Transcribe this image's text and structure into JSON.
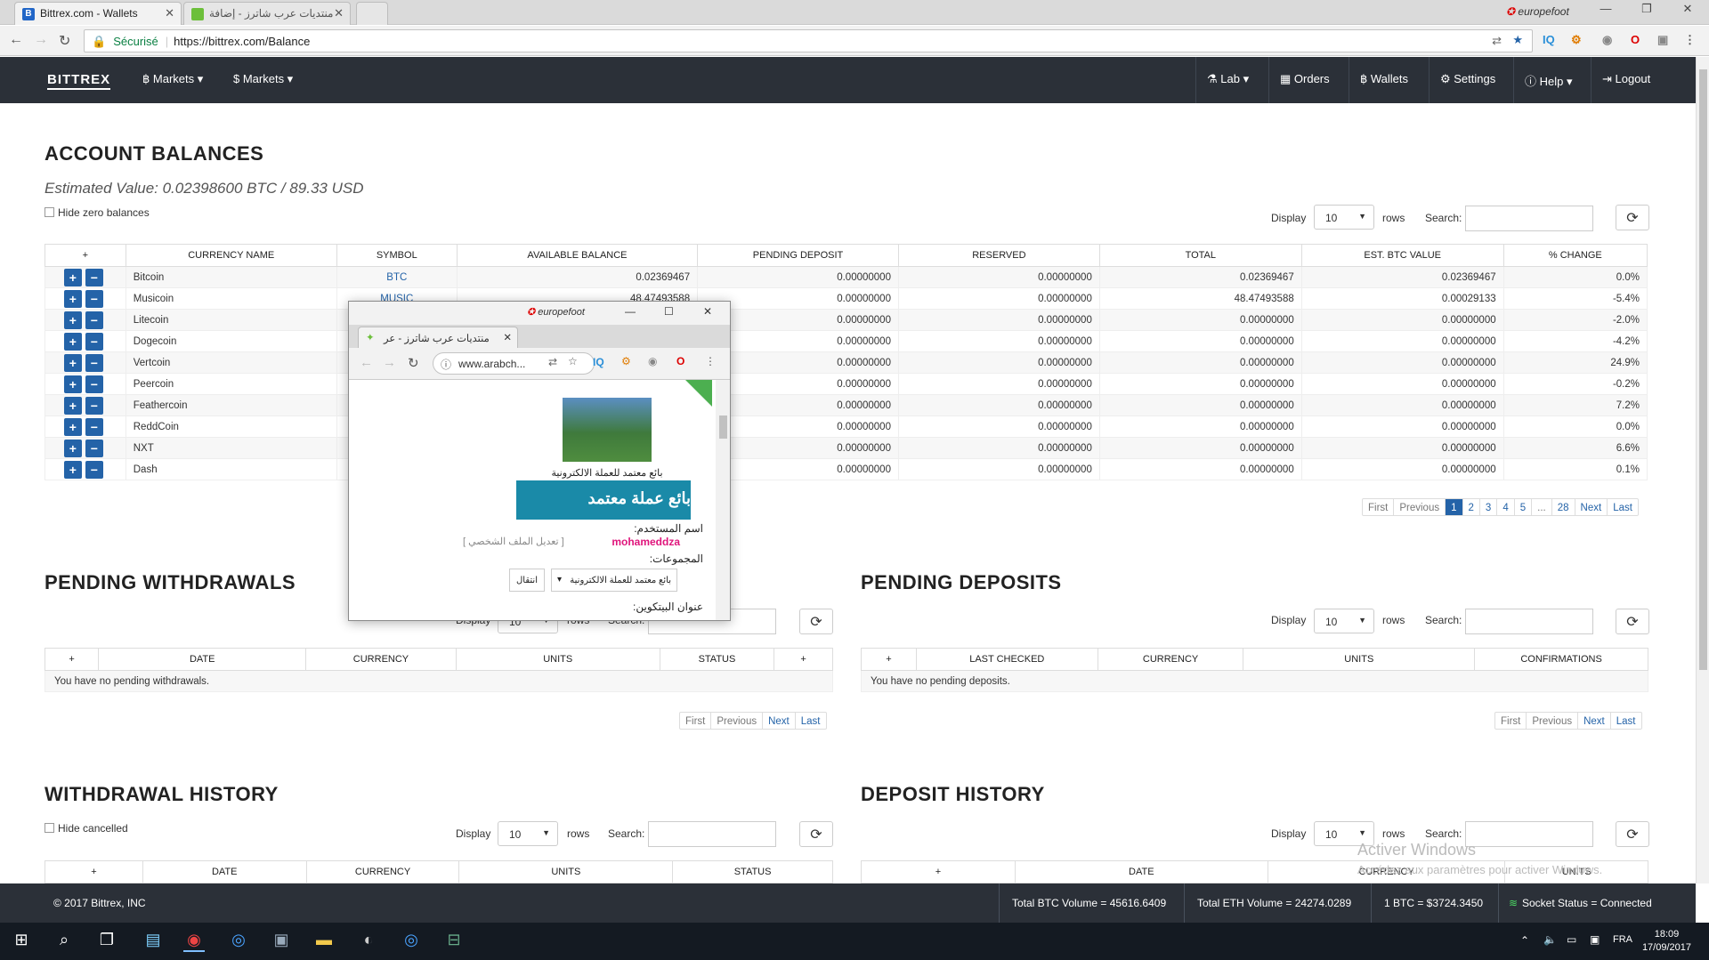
{
  "browser": {
    "tabs": [
      {
        "title": "Bittrex.com - Wallets",
        "favicon": "B"
      },
      {
        "title": "منتديات عرب شاترز - إضافة",
        "favicon": ""
      }
    ],
    "profile": "europefoot",
    "secure_label": "Sécurisé",
    "url": "https://bittrex.com/Balance",
    "ext_iq": "IQ"
  },
  "nav": {
    "brand": "BITTREX",
    "left": [
      {
        "label": "฿ Markets ▾"
      },
      {
        "label": "$ Markets ▾"
      }
    ],
    "right": [
      {
        "label": "⚗ Lab ▾"
      },
      {
        "label": "▦ Orders"
      },
      {
        "label": "฿ Wallets"
      },
      {
        "label": "⚙ Settings"
      },
      {
        "label": "ⓘ Help ▾"
      },
      {
        "label": "⇥ Logout"
      }
    ]
  },
  "account": {
    "title": "ACCOUNT BALANCES",
    "estimated": "Estimated Value: 0.02398600 BTC / 89.33 USD",
    "hide_zero": "Hide zero balances",
    "display_label": "Display",
    "display_value": "10",
    "rows_label": "rows",
    "search_label": "Search:",
    "columns": [
      "+",
      "CURRENCY NAME",
      "SYMBOL",
      "AVAILABLE BALANCE",
      "PENDING DEPOSIT",
      "RESERVED",
      "TOTAL",
      "EST. BTC VALUE",
      "% CHANGE"
    ],
    "rows": [
      {
        "name": "Bitcoin",
        "symbol": "BTC",
        "available": "0.02369467",
        "pending": "0.00000000",
        "reserved": "0.00000000",
        "total": "0.02369467",
        "btc": "0.02369467",
        "change": "0.0%"
      },
      {
        "name": "Musicoin",
        "symbol": "MUSIC",
        "available": "48.47493588",
        "pending": "0.00000000",
        "reserved": "0.00000000",
        "total": "48.47493588",
        "btc": "0.00029133",
        "change": "-5.4%"
      },
      {
        "name": "Litecoin",
        "symbol": "",
        "available": "",
        "pending": "0.00000000",
        "reserved": "0.00000000",
        "total": "0.00000000",
        "btc": "0.00000000",
        "change": "-2.0%"
      },
      {
        "name": "Dogecoin",
        "symbol": "",
        "available": "",
        "pending": "0.00000000",
        "reserved": "0.00000000",
        "total": "0.00000000",
        "btc": "0.00000000",
        "change": "-4.2%"
      },
      {
        "name": "Vertcoin",
        "symbol": "",
        "available": "",
        "pending": "0.00000000",
        "reserved": "0.00000000",
        "total": "0.00000000",
        "btc": "0.00000000",
        "change": "24.9%"
      },
      {
        "name": "Peercoin",
        "symbol": "",
        "available": "",
        "pending": "0.00000000",
        "reserved": "0.00000000",
        "total": "0.00000000",
        "btc": "0.00000000",
        "change": "-0.2%"
      },
      {
        "name": "Feathercoin",
        "symbol": "",
        "available": "",
        "pending": "0.00000000",
        "reserved": "0.00000000",
        "total": "0.00000000",
        "btc": "0.00000000",
        "change": "7.2%"
      },
      {
        "name": "ReddCoin",
        "symbol": "",
        "available": "",
        "pending": "0.00000000",
        "reserved": "0.00000000",
        "total": "0.00000000",
        "btc": "0.00000000",
        "change": "0.0%"
      },
      {
        "name": "NXT",
        "symbol": "",
        "available": "",
        "pending": "0.00000000",
        "reserved": "0.00000000",
        "total": "0.00000000",
        "btc": "0.00000000",
        "change": "6.6%"
      },
      {
        "name": "Dash",
        "symbol": "",
        "available": "",
        "pending": "0.00000000",
        "reserved": "0.00000000",
        "total": "0.00000000",
        "btc": "0.00000000",
        "change": "0.1%"
      }
    ],
    "pager": [
      "First",
      "Previous",
      "1",
      "2",
      "3",
      "4",
      "5",
      "...",
      "28",
      "Next",
      "Last"
    ]
  },
  "pending_withdrawals": {
    "title": "PENDING WITHDRAWALS",
    "display_label": "Display",
    "display_value": "10",
    "rows_label": "rows",
    "search_label": "Search:",
    "columns": [
      "+",
      "DATE",
      "CURRENCY",
      "UNITS",
      "STATUS",
      "+"
    ],
    "empty": "You have no pending withdrawals.",
    "pager": [
      "First",
      "Previous",
      "Next",
      "Last"
    ]
  },
  "pending_deposits": {
    "title": "PENDING DEPOSITS",
    "display_label": "Display",
    "display_value": "10",
    "rows_label": "rows",
    "search_label": "Search:",
    "columns": [
      "+",
      "LAST CHECKED",
      "CURRENCY",
      "UNITS",
      "CONFIRMATIONS"
    ],
    "empty": "You have no pending deposits.",
    "pager": [
      "First",
      "Previous",
      "Next",
      "Last"
    ]
  },
  "withdrawal_history": {
    "title": "WITHDRAWAL HISTORY",
    "hide_cancelled": "Hide cancelled",
    "display_label": "Display",
    "display_value": "10",
    "rows_label": "rows",
    "search_label": "Search:",
    "columns": [
      "+",
      "DATE",
      "CURRENCY",
      "UNITS",
      "STATUS"
    ]
  },
  "deposit_history": {
    "title": "DEPOSIT HISTORY",
    "display_label": "Display",
    "display_value": "10",
    "rows_label": "rows",
    "search_label": "Search:",
    "columns": [
      "+",
      "DATE",
      "CURRENCY",
      "UNITS"
    ]
  },
  "footer": {
    "copyright": "© 2017 Bittrex, INC",
    "btc_volume": "Total BTC Volume = 45616.6409",
    "eth_volume": "Total ETH Volume = 24274.0289",
    "btc_price": "1 BTC = $3724.3450",
    "socket": "Socket Status = Connected"
  },
  "watermark": {
    "line1": "Activer Windows",
    "line2": "Accédez aux paramètres pour activer Windows."
  },
  "popup": {
    "profile": "europefoot",
    "tab_title": "منتديات عرب شاترز - عر",
    "url": "www.arabch...",
    "badge_text": "بائع معتمد للعملة الالكترونية",
    "banner_text": "بائع عملة معتمد",
    "username_label": "اسم المستخدم:",
    "username": "mohameddza",
    "edit_profile": "[ تعديل الملف الشخصي ]",
    "groups_label": "المجموعات:",
    "group_value": "بائع معتمد للعملة الالكترونية",
    "go_button": "انتقال",
    "bitcoin_address": "عنوان البيتكوين:"
  },
  "taskbar": {
    "lang": "FRA",
    "time": "18:09",
    "date": "17/09/2017"
  },
  "colors": {
    "nav_bg": "#2b3038",
    "accent_blue": "#2463a8",
    "username_pink": "#e0157c"
  }
}
